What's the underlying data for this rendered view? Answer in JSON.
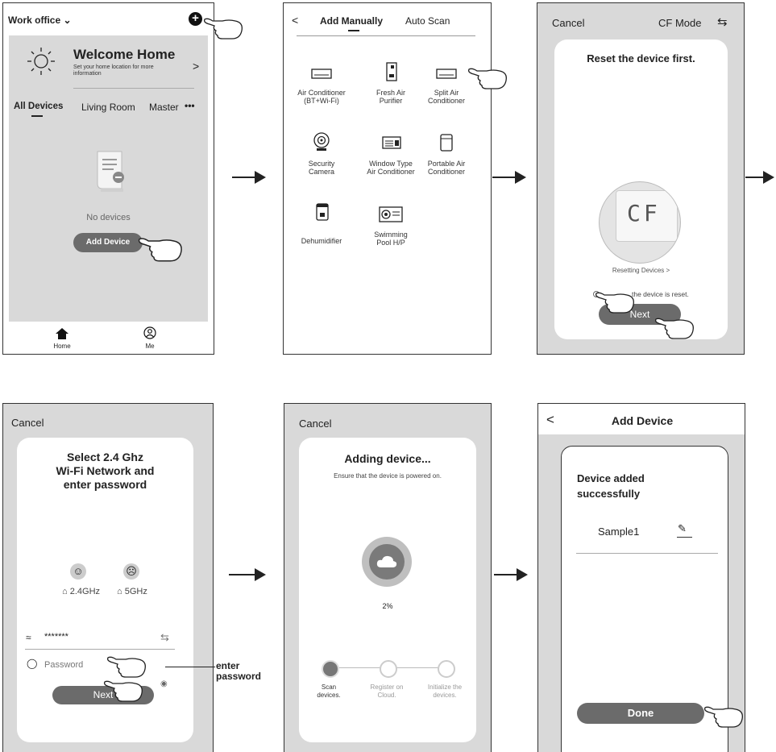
{
  "screen1": {
    "location": "Work office",
    "welcome_title": "Welcome Home",
    "welcome_sub": "Set your home location for more information",
    "tabs": [
      "All Devices",
      "Living Room",
      "Master"
    ],
    "more": "•••",
    "empty_text": "No devices",
    "add_button": "Add Device",
    "nav": [
      "Home",
      "Me"
    ]
  },
  "screen2": {
    "tab_manual": "Add Manually",
    "tab_auto": "Auto Scan",
    "devices": [
      [
        "Air Conditioner",
        "(BT+Wi-Fi)"
      ],
      [
        "Fresh Air",
        "Purifier"
      ],
      [
        "Split Air",
        "Conditioner"
      ],
      [
        "Security",
        "Camera"
      ],
      [
        "Window Type",
        "Air Conditioner"
      ],
      [
        "Portable Air",
        "Conditioner"
      ],
      [
        "Dehumidifier",
        ""
      ],
      [
        "Swimming",
        "Pool H/P"
      ]
    ]
  },
  "screen3": {
    "cancel": "Cancel",
    "mode": "CF Mode",
    "title": "Reset the device first.",
    "display": "CF",
    "resetting": "Resetting Devices >",
    "confirm": "the device is reset.",
    "next": "Next"
  },
  "screen4": {
    "cancel": "Cancel",
    "title1": "Select 2.4 Ghz",
    "title2": "Wi-Fi Network and",
    "title3": "enter password",
    "band_good": "2.4GHz",
    "band_bad": "5GHz",
    "ssid": "*******",
    "password_placeholder": "Password",
    "next": "Next",
    "annotation1": "enter",
    "annotation2": "password"
  },
  "screen5": {
    "cancel": "Cancel",
    "title": "Adding device...",
    "sub": "Ensure that the device is powered on.",
    "percent": "2%",
    "progress": 0.02,
    "steps": [
      [
        "Scan",
        "devices."
      ],
      [
        "Register on",
        "Cloud."
      ],
      [
        "Initialize the",
        "devices."
      ]
    ]
  },
  "screen6": {
    "back": "<",
    "title": "Add Device",
    "msg1": "Device added",
    "msg2": "successfully",
    "device_name": "Sample1",
    "done": "Done"
  },
  "colors": {
    "pill": "#6b6b6b",
    "phone_bg": "#d9d9d9"
  }
}
